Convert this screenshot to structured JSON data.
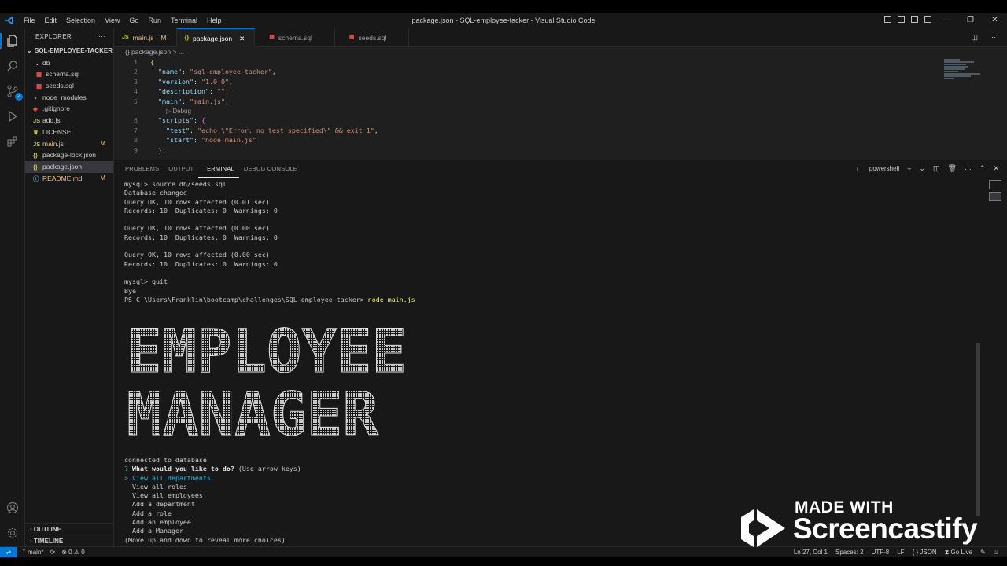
{
  "window": {
    "title": "package.json - SQL-employee-tacker - Visual Studio Code",
    "menu": [
      "File",
      "Edit",
      "Selection",
      "View",
      "Go",
      "Run",
      "Terminal",
      "Help"
    ]
  },
  "sidebar": {
    "title": "EXPLORER",
    "project": "SQL-EMPLOYEE-TACKER",
    "items": [
      {
        "label": "db",
        "kind": "folder-open",
        "depth": 1
      },
      {
        "label": "schema.sql",
        "kind": "db",
        "depth": 2
      },
      {
        "label": "seeds.sql",
        "kind": "db",
        "depth": 2
      },
      {
        "label": "node_modules",
        "kind": "folder",
        "depth": 1
      },
      {
        "label": ".gitignore",
        "kind": "git",
        "depth": 1
      },
      {
        "label": "add.js",
        "kind": "js",
        "depth": 1
      },
      {
        "label": "LICENSE",
        "kind": "license",
        "depth": 1
      },
      {
        "label": "main.js",
        "kind": "js",
        "depth": 1,
        "status": "M"
      },
      {
        "label": "package-lock.json",
        "kind": "json",
        "depth": 1
      },
      {
        "label": "package.json",
        "kind": "json",
        "depth": 1,
        "selected": true
      },
      {
        "label": "README.md",
        "kind": "md",
        "depth": 1,
        "status": "M"
      }
    ],
    "outline": "OUTLINE",
    "timeline": "TIMELINE"
  },
  "tabs": [
    {
      "label": "main.js",
      "kind": "js",
      "status": "M"
    },
    {
      "label": "package.json",
      "kind": "json",
      "active": true
    },
    {
      "label": "schema.sql",
      "kind": "db"
    },
    {
      "label": "seeds.sql",
      "kind": "db"
    }
  ],
  "breadcrumb": "{} package.json > ...",
  "code": {
    "lines": [
      "1",
      "2",
      "3",
      "4",
      "5",
      "",
      "6",
      "7",
      "8",
      "9"
    ],
    "codelens": "Debug"
  },
  "panel": {
    "tabs": [
      "PROBLEMS",
      "OUTPUT",
      "TERMINAL",
      "DEBUG CONSOLE"
    ],
    "active_tab": "TERMINAL",
    "shell": "powershell"
  },
  "terminal": {
    "lines": [
      "mysql> source db/seeds.sql",
      "Database changed",
      "Query OK, 10 rows affected (0.01 sec)",
      "Records: 10  Duplicates: 0  Warnings: 0",
      "",
      "Query OK, 10 rows affected (0.00 sec)",
      "Records: 10  Duplicates: 0  Warnings: 0",
      "",
      "Query OK, 10 rows affected (0.00 sec)",
      "Records: 10  Duplicates: 0  Warnings: 0",
      "",
      "mysql> quit",
      "Bye"
    ],
    "prompt": "PS C:\\Users\\Franklin\\bootcamp\\challenges\\SQL-employee-tacker>",
    "command": "node main.js",
    "banner_line1": "EMPLOYEE",
    "banner_line2": "MANAGER",
    "connected": "connected to database",
    "question_mark": "?",
    "question": "What would you like to do?",
    "hint": "(Use arrow keys)",
    "pointer": ">",
    "choices": [
      "View all departments",
      "View all roles",
      "View all employees",
      "Add a department",
      "Add a role",
      "Add an employee",
      "Add a Manager"
    ],
    "footer": "(Move up and down to reveal more choices)"
  },
  "statusbar": {
    "branch": "main*",
    "errors": "0",
    "warnings": "0",
    "position": "Ln 27, Col 1",
    "spaces": "Spaces: 2",
    "encoding": "UTF-8",
    "eol": "LF",
    "language": "{ } JSON",
    "golive": "Go Live"
  },
  "watermark": {
    "line1": "MADE WITH",
    "line2": "Screencastify"
  },
  "colors": {
    "accent": "#0078d4",
    "modified": "#e2c08d",
    "sql_icon": "#f14c4c",
    "json_icon": "#cbcb41",
    "js_icon": "#cbcb41"
  }
}
